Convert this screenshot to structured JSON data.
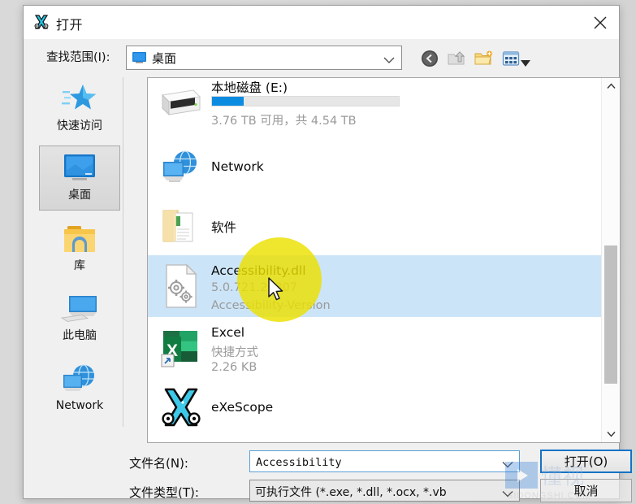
{
  "window": {
    "title": "打开",
    "icon": "exescope-icon",
    "close_label": "✕"
  },
  "lookin": {
    "label": "查找范围(I):",
    "value": "桌面",
    "icon": "desktop-monitor-icon"
  },
  "toolbar": {
    "back": "back-icon",
    "up": "up-one-level-icon",
    "new_folder": "new-folder-icon",
    "views": "views-icon",
    "views_arrow": "▾"
  },
  "places": {
    "items": [
      {
        "label": "快速访问",
        "icon": "star-icon",
        "selected": false
      },
      {
        "label": "桌面",
        "icon": "desktop-monitor-icon",
        "selected": true
      },
      {
        "label": "库",
        "icon": "library-folder-icon",
        "selected": false
      },
      {
        "label": "此电脑",
        "icon": "this-pc-icon",
        "selected": false
      },
      {
        "label": "Network",
        "icon": "network-icon",
        "selected": false
      }
    ]
  },
  "filelist": {
    "rows": [
      {
        "kind": "drive",
        "name": "本地磁盘 (E:)",
        "icon": "hard-drive-icon",
        "usage_text": "3.76 TB 可用，共 4.54 TB",
        "used_percent": 17,
        "selected": false
      },
      {
        "kind": "network",
        "name": "Network",
        "icon": "network-icon",
        "selected": false
      },
      {
        "kind": "folder",
        "name": "软件",
        "icon": "documents-folder-icon",
        "selected": false
      },
      {
        "kind": "file",
        "name": "Accessibility.dll",
        "icon": "dll-gear-file-icon",
        "line2": "5.0.721.26307",
        "line3": "Accessibility-Version",
        "selected": true
      },
      {
        "kind": "shortcut",
        "name": "Excel",
        "icon": "excel-shortcut-icon",
        "line2": "快捷方式",
        "line3": "2.26 KB",
        "selected": false
      },
      {
        "kind": "app",
        "name": "eXeScope",
        "icon": "exescope-icon",
        "selected": false
      }
    ]
  },
  "scrollbar": {
    "up_arrow": "⌃",
    "down_arrow": "⌄"
  },
  "form": {
    "filename_label": "文件名(N):",
    "filename_value": "Accessibility",
    "filename_placeholder": "",
    "filetype_label": "文件类型(T):",
    "filetype_value": "可执行文件 (*.exe, *.dll, *.ocx, *.vb",
    "open_button": "打开(O)",
    "cancel_button": "取消"
  },
  "watermark": {
    "text_cn": "懂视",
    "url": "SIDONGSHI.COM"
  },
  "colors": {
    "selection": "#cce4f7",
    "accent_blue": "#0c8ce1",
    "focus_border": "#1573c6",
    "halo_yellow": "#ece000"
  }
}
